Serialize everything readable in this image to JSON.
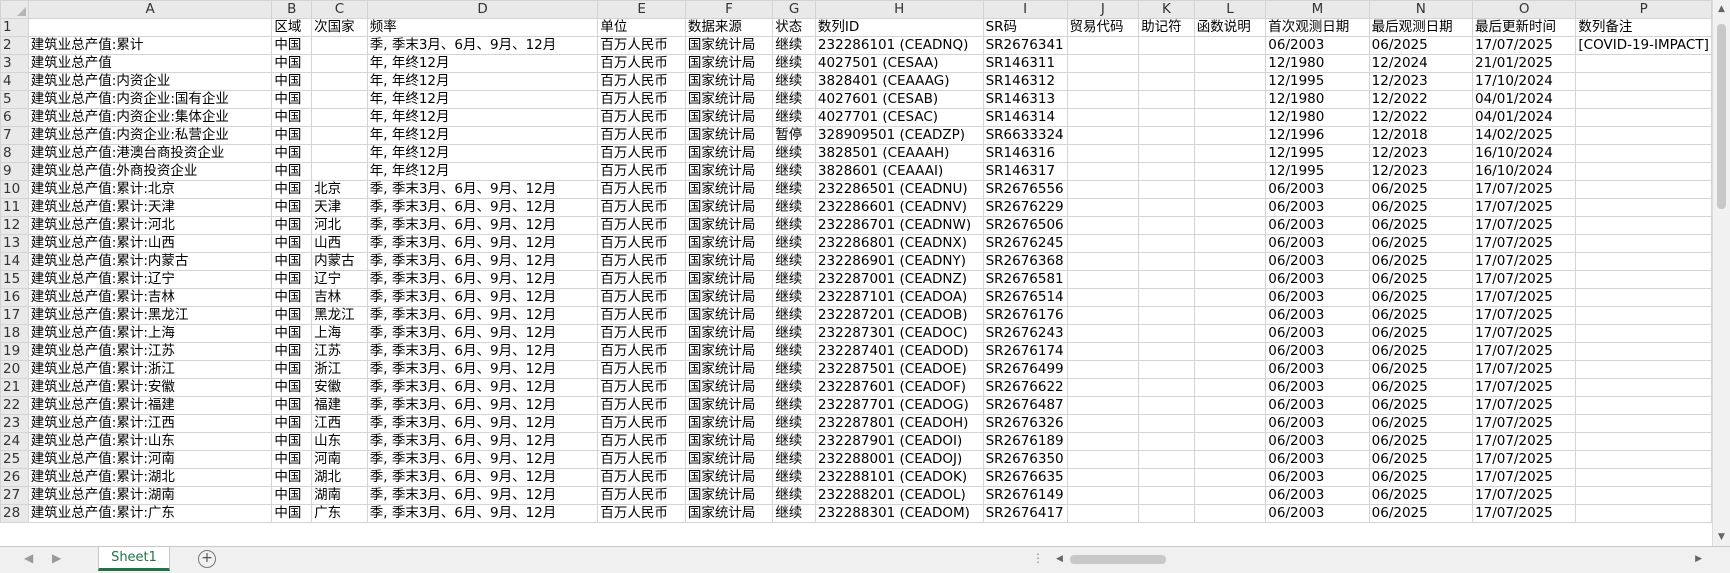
{
  "columns": [
    "A",
    "B",
    "C",
    "D",
    "E",
    "F",
    "G",
    "H",
    "I",
    "J",
    "K",
    "L",
    "M",
    "N",
    "O",
    "P"
  ],
  "header_row": [
    "",
    "区域",
    "次国家",
    "频率",
    "单位",
    "数据来源",
    "状态",
    "数列ID",
    "SR码",
    "贸易代码",
    "助记符",
    "函数说明",
    "首次观测日期",
    "最后观测日期",
    "最后更新时间",
    "数列备注"
  ],
  "rows": [
    [
      "建筑业总产值:累计",
      "中国",
      "",
      "季, 季末3月、6月、9月、12月",
      "百万人民币",
      "国家统计局",
      "继续",
      "232286101 (CEADNQ)",
      "SR2676341",
      "",
      "",
      "",
      "06/2003",
      "06/2025",
      "17/07/2025",
      "[COVID-19-IMPACT]"
    ],
    [
      "建筑业总产值",
      "中国",
      "",
      "年, 年终12月",
      "百万人民币",
      "国家统计局",
      "继续",
      "4027501 (CESAA)",
      "SR146311",
      "",
      "",
      "",
      "12/1980",
      "12/2024",
      "21/01/2025",
      ""
    ],
    [
      "建筑业总产值:内资企业",
      "中国",
      "",
      "年, 年终12月",
      "百万人民币",
      "国家统计局",
      "继续",
      "3828401 (CEAAAG)",
      "SR146312",
      "",
      "",
      "",
      "12/1995",
      "12/2023",
      "17/10/2024",
      ""
    ],
    [
      "建筑业总产值:内资企业:国有企业",
      "中国",
      "",
      "年, 年终12月",
      "百万人民币",
      "国家统计局",
      "继续",
      "4027601 (CESAB)",
      "SR146313",
      "",
      "",
      "",
      "12/1980",
      "12/2022",
      "04/01/2024",
      ""
    ],
    [
      "建筑业总产值:内资企业:集体企业",
      "中国",
      "",
      "年, 年终12月",
      "百万人民币",
      "国家统计局",
      "继续",
      "4027701 (CESAC)",
      "SR146314",
      "",
      "",
      "",
      "12/1980",
      "12/2022",
      "04/01/2024",
      ""
    ],
    [
      "建筑业总产值:内资企业:私营企业",
      "中国",
      "",
      "年, 年终12月",
      "百万人民币",
      "国家统计局",
      "暂停",
      "328909501 (CEADZP)",
      "SR6633324",
      "",
      "",
      "",
      "12/1996",
      "12/2018",
      "14/02/2025",
      ""
    ],
    [
      "建筑业总产值:港澳台商投资企业",
      "中国",
      "",
      "年, 年终12月",
      "百万人民币",
      "国家统计局",
      "继续",
      "3828501 (CEAAAH)",
      "SR146316",
      "",
      "",
      "",
      "12/1995",
      "12/2023",
      "16/10/2024",
      ""
    ],
    [
      "建筑业总产值:外商投资企业",
      "中国",
      "",
      "年, 年终12月",
      "百万人民币",
      "国家统计局",
      "继续",
      "3828601 (CEAAAI)",
      "SR146317",
      "",
      "",
      "",
      "12/1995",
      "12/2023",
      "16/10/2024",
      ""
    ],
    [
      "建筑业总产值:累计:北京",
      "中国",
      "北京",
      "季, 季末3月、6月、9月、12月",
      "百万人民币",
      "国家统计局",
      "继续",
      "232286501 (CEADNU)",
      "SR2676556",
      "",
      "",
      "",
      "06/2003",
      "06/2025",
      "17/07/2025",
      ""
    ],
    [
      "建筑业总产值:累计:天津",
      "中国",
      "天津",
      "季, 季末3月、6月、9月、12月",
      "百万人民币",
      "国家统计局",
      "继续",
      "232286601 (CEADNV)",
      "SR2676229",
      "",
      "",
      "",
      "06/2003",
      "06/2025",
      "17/07/2025",
      ""
    ],
    [
      "建筑业总产值:累计:河北",
      "中国",
      "河北",
      "季, 季末3月、6月、9月、12月",
      "百万人民币",
      "国家统计局",
      "继续",
      "232286701 (CEADNW)",
      "SR2676506",
      "",
      "",
      "",
      "06/2003",
      "06/2025",
      "17/07/2025",
      ""
    ],
    [
      "建筑业总产值:累计:山西",
      "中国",
      "山西",
      "季, 季末3月、6月、9月、12月",
      "百万人民币",
      "国家统计局",
      "继续",
      "232286801 (CEADNX)",
      "SR2676245",
      "",
      "",
      "",
      "06/2003",
      "06/2025",
      "17/07/2025",
      ""
    ],
    [
      "建筑业总产值:累计:内蒙古",
      "中国",
      "内蒙古",
      "季, 季末3月、6月、9月、12月",
      "百万人民币",
      "国家统计局",
      "继续",
      "232286901 (CEADNY)",
      "SR2676368",
      "",
      "",
      "",
      "06/2003",
      "06/2025",
      "17/07/2025",
      ""
    ],
    [
      "建筑业总产值:累计:辽宁",
      "中国",
      "辽宁",
      "季, 季末3月、6月、9月、12月",
      "百万人民币",
      "国家统计局",
      "继续",
      "232287001 (CEADNZ)",
      "SR2676581",
      "",
      "",
      "",
      "06/2003",
      "06/2025",
      "17/07/2025",
      ""
    ],
    [
      "建筑业总产值:累计:吉林",
      "中国",
      "吉林",
      "季, 季末3月、6月、9月、12月",
      "百万人民币",
      "国家统计局",
      "继续",
      "232287101 (CEADOA)",
      "SR2676514",
      "",
      "",
      "",
      "06/2003",
      "06/2025",
      "17/07/2025",
      ""
    ],
    [
      "建筑业总产值:累计:黑龙江",
      "中国",
      "黑龙江",
      "季, 季末3月、6月、9月、12月",
      "百万人民币",
      "国家统计局",
      "继续",
      "232287201 (CEADOB)",
      "SR2676176",
      "",
      "",
      "",
      "06/2003",
      "06/2025",
      "17/07/2025",
      ""
    ],
    [
      "建筑业总产值:累计:上海",
      "中国",
      "上海",
      "季, 季末3月、6月、9月、12月",
      "百万人民币",
      "国家统计局",
      "继续",
      "232287301 (CEADOC)",
      "SR2676243",
      "",
      "",
      "",
      "06/2003",
      "06/2025",
      "17/07/2025",
      ""
    ],
    [
      "建筑业总产值:累计:江苏",
      "中国",
      "江苏",
      "季, 季末3月、6月、9月、12月",
      "百万人民币",
      "国家统计局",
      "继续",
      "232287401 (CEADOD)",
      "SR2676174",
      "",
      "",
      "",
      "06/2003",
      "06/2025",
      "17/07/2025",
      ""
    ],
    [
      "建筑业总产值:累计:浙江",
      "中国",
      "浙江",
      "季, 季末3月、6月、9月、12月",
      "百万人民币",
      "国家统计局",
      "继续",
      "232287501 (CEADOE)",
      "SR2676499",
      "",
      "",
      "",
      "06/2003",
      "06/2025",
      "17/07/2025",
      ""
    ],
    [
      "建筑业总产值:累计:安徽",
      "中国",
      "安徽",
      "季, 季末3月、6月、9月、12月",
      "百万人民币",
      "国家统计局",
      "继续",
      "232287601 (CEADOF)",
      "SR2676622",
      "",
      "",
      "",
      "06/2003",
      "06/2025",
      "17/07/2025",
      ""
    ],
    [
      "建筑业总产值:累计:福建",
      "中国",
      "福建",
      "季, 季末3月、6月、9月、12月",
      "百万人民币",
      "国家统计局",
      "继续",
      "232287701 (CEADOG)",
      "SR2676487",
      "",
      "",
      "",
      "06/2003",
      "06/2025",
      "17/07/2025",
      ""
    ],
    [
      "建筑业总产值:累计:江西",
      "中国",
      "江西",
      "季, 季末3月、6月、9月、12月",
      "百万人民币",
      "国家统计局",
      "继续",
      "232287801 (CEADOH)",
      "SR2676326",
      "",
      "",
      "",
      "06/2003",
      "06/2025",
      "17/07/2025",
      ""
    ],
    [
      "建筑业总产值:累计:山东",
      "中国",
      "山东",
      "季, 季末3月、6月、9月、12月",
      "百万人民币",
      "国家统计局",
      "继续",
      "232287901 (CEADOI)",
      "SR2676189",
      "",
      "",
      "",
      "06/2003",
      "06/2025",
      "17/07/2025",
      ""
    ],
    [
      "建筑业总产值:累计:河南",
      "中国",
      "河南",
      "季, 季末3月、6月、9月、12月",
      "百万人民币",
      "国家统计局",
      "继续",
      "232288001 (CEADOJ)",
      "SR2676350",
      "",
      "",
      "",
      "06/2003",
      "06/2025",
      "17/07/2025",
      ""
    ],
    [
      "建筑业总产值:累计:湖北",
      "中国",
      "湖北",
      "季, 季末3月、6月、9月、12月",
      "百万人民币",
      "国家统计局",
      "继续",
      "232288101 (CEADOK)",
      "SR2676635",
      "",
      "",
      "",
      "06/2003",
      "06/2025",
      "17/07/2025",
      ""
    ],
    [
      "建筑业总产值:累计:湖南",
      "中国",
      "湖南",
      "季, 季末3月、6月、9月、12月",
      "百万人民币",
      "国家统计局",
      "继续",
      "232288201 (CEADOL)",
      "SR2676149",
      "",
      "",
      "",
      "06/2003",
      "06/2025",
      "17/07/2025",
      ""
    ],
    [
      "建筑业总产值:累计:广东",
      "中国",
      "广东",
      "季, 季末3月、6月、9月、12月",
      "百万人民币",
      "国家统计局",
      "继续",
      "232288301 (CEADOM)",
      "SR2676417",
      "",
      "",
      "",
      "06/2003",
      "06/2025",
      "17/07/2025",
      ""
    ]
  ],
  "sheet_tab": "Sheet1",
  "icons": {
    "add_sheet": "plus-circle-icon",
    "nav_prev": "chevron-left-icon",
    "nav_next": "chevron-right-icon",
    "scroll_up": "triangle-up-icon",
    "scroll_down": "triangle-down-icon",
    "scroll_left": "triangle-left-icon",
    "scroll_right": "triangle-right-icon",
    "split": "vertical-dots-icon"
  },
  "colors": {
    "accent": "#217346",
    "header_bg": "#e9e9e9",
    "grid_line": "#d4d4d4"
  }
}
